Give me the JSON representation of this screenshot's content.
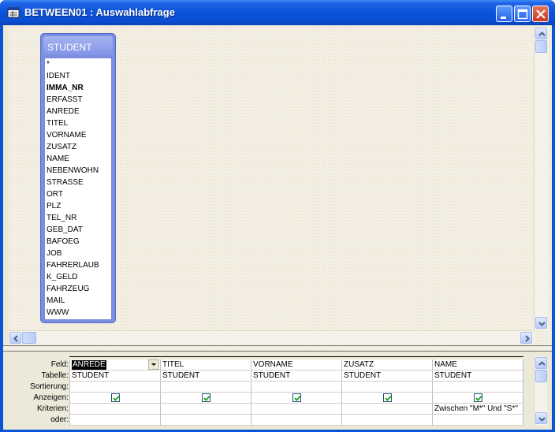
{
  "window": {
    "title": "BETWEEN01 : Auswahlabfrage",
    "accent": "#0a54d8"
  },
  "field_list": {
    "title": "STUDENT",
    "fields": [
      {
        "name": "*",
        "primary": false
      },
      {
        "name": "IDENT",
        "primary": false
      },
      {
        "name": "IMMA_NR",
        "primary": true
      },
      {
        "name": "ERFASST",
        "primary": false
      },
      {
        "name": "ANREDE",
        "primary": false
      },
      {
        "name": "TITEL",
        "primary": false
      },
      {
        "name": "VORNAME",
        "primary": false
      },
      {
        "name": "ZUSATZ",
        "primary": false
      },
      {
        "name": "NAME",
        "primary": false
      },
      {
        "name": "NEBENWOHN",
        "primary": false
      },
      {
        "name": "STRASSE",
        "primary": false
      },
      {
        "name": "ORT",
        "primary": false
      },
      {
        "name": "PLZ",
        "primary": false
      },
      {
        "name": "TEL_NR",
        "primary": false
      },
      {
        "name": "GEB_DAT",
        "primary": false
      },
      {
        "name": "BAFOEG",
        "primary": false
      },
      {
        "name": "JOB",
        "primary": false
      },
      {
        "name": "FAHRERLAUB",
        "primary": false
      },
      {
        "name": "K_GELD",
        "primary": false
      },
      {
        "name": "FAHRZEUG",
        "primary": false
      },
      {
        "name": "MAIL",
        "primary": false
      },
      {
        "name": "WWW",
        "primary": false
      }
    ]
  },
  "grid": {
    "row_labels": [
      "Feld:",
      "Tabelle:",
      "Sortierung:",
      "Anzeigen:",
      "Kriterien:",
      "oder:"
    ],
    "columns": [
      {
        "feld": "ANREDE",
        "tabelle": "STUDENT",
        "sortierung": "",
        "anzeigen": true,
        "kriterien": "",
        "oder": "",
        "selected": true
      },
      {
        "feld": "TITEL",
        "tabelle": "STUDENT",
        "sortierung": "",
        "anzeigen": true,
        "kriterien": "",
        "oder": "",
        "selected": false
      },
      {
        "feld": "VORNAME",
        "tabelle": "STUDENT",
        "sortierung": "",
        "anzeigen": true,
        "kriterien": "",
        "oder": "",
        "selected": false
      },
      {
        "feld": "ZUSATZ",
        "tabelle": "STUDENT",
        "sortierung": "",
        "anzeigen": true,
        "kriterien": "",
        "oder": "",
        "selected": false
      },
      {
        "feld": "NAME",
        "tabelle": "STUDENT",
        "sortierung": "",
        "anzeigen": true,
        "kriterien": "Zwischen \"M*\" Und \"S*\"",
        "oder": "",
        "selected": false
      }
    ]
  }
}
